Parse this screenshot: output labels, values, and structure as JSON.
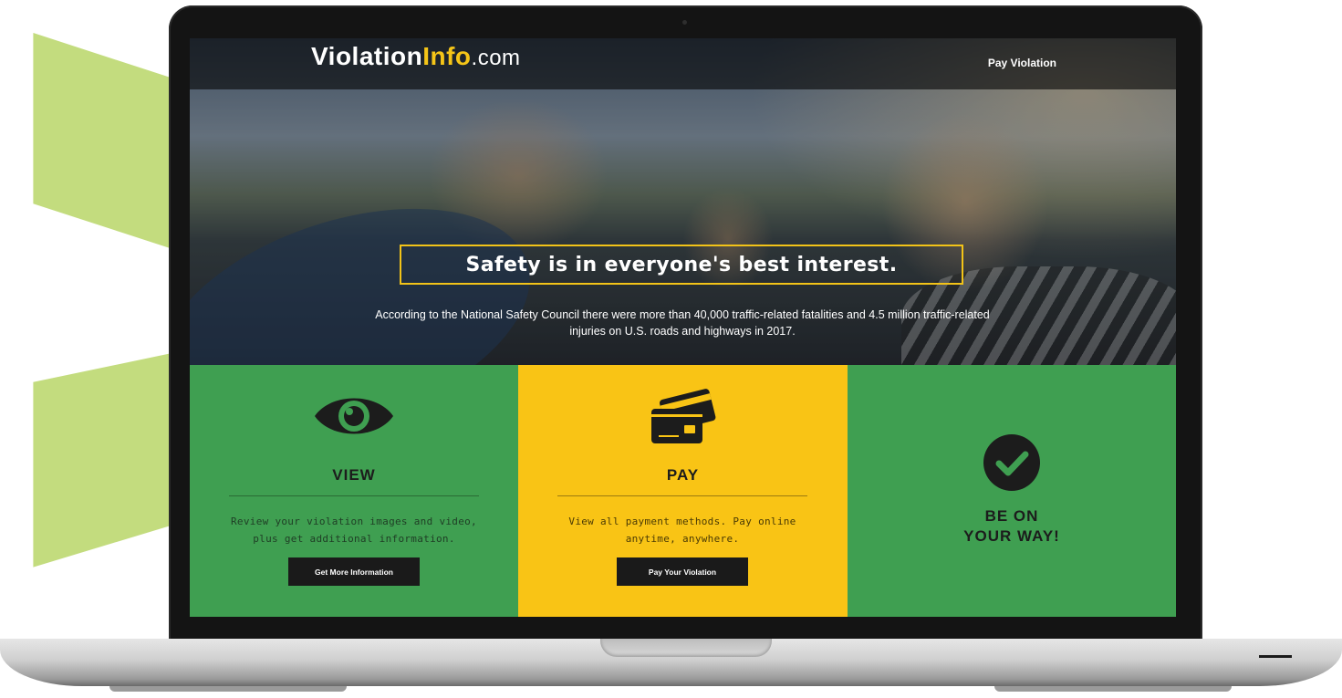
{
  "site": {
    "logo_main": "Violation",
    "logo_highlight": "Info",
    "logo_tld": ".com",
    "nav_pay": "Pay Violation"
  },
  "hero": {
    "headline": "Safety is in everyone's best interest.",
    "subtext": "According to the National Safety Council there were more than 40,000 traffic-related fatalities and 4.5 million traffic-related injuries on U.S. roads and highways in 2017."
  },
  "panels": {
    "view": {
      "icon": "eye-icon",
      "title": "VIEW",
      "description": "Review your violation images and video, plus get additional information.",
      "button": "Get More Information",
      "color": "#3f9f51"
    },
    "pay": {
      "icon": "credit-card-icon",
      "title": "PAY",
      "description": "View all payment methods. Pay online anytime, anywhere.",
      "button": "Pay Your Violation",
      "color": "#f9c415"
    },
    "way": {
      "icon": "check-circle-icon",
      "title_line1": "BE ON",
      "title_line2": "YOUR WAY!",
      "color": "#3f9f51"
    }
  },
  "colors": {
    "accent_yellow": "#f2c318",
    "accent_green": "#3f9f51",
    "decor_green": "#c3dc7e"
  }
}
